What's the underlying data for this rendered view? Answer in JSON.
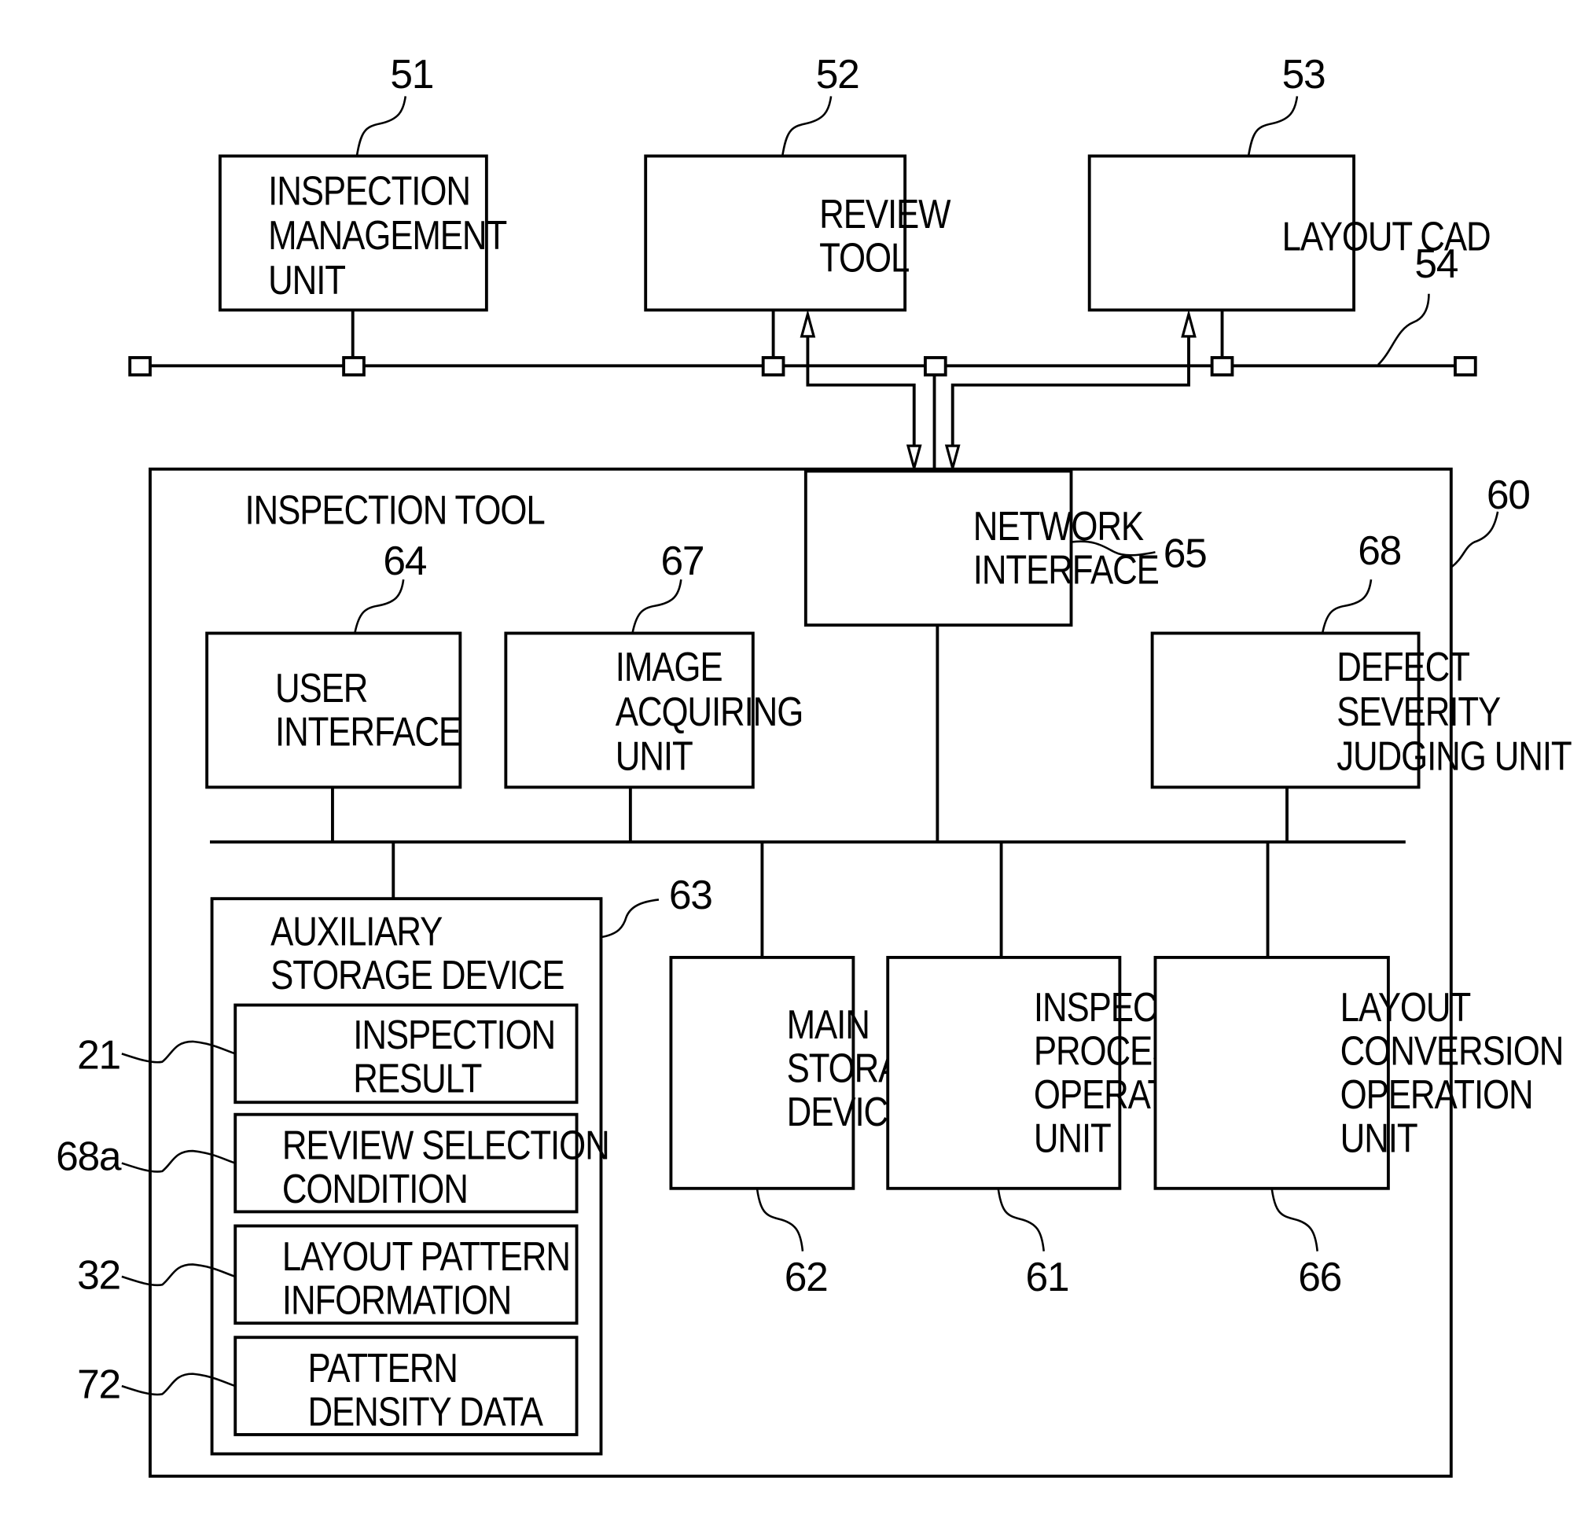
{
  "title": "Inspection system block diagram",
  "network_ref": "54",
  "top_units": [
    {
      "ref": "51",
      "lines": [
        "INSPECTION",
        "MANAGEMENT",
        "UNIT"
      ]
    },
    {
      "ref": "52",
      "lines": [
        "REVIEW",
        "TOOL"
      ]
    },
    {
      "ref": "53",
      "lines": [
        "LAYOUT  CAD"
      ]
    }
  ],
  "inspection_tool": {
    "ref": "60",
    "title": "INSPECTION  TOOL",
    "network_interface": {
      "ref": "65",
      "lines": [
        "NETWORK",
        "INTERFACE"
      ]
    },
    "user_interface": {
      "ref": "64",
      "lines": [
        "USER",
        "INTERFACE"
      ]
    },
    "image_acquiring_unit": {
      "ref": "67",
      "lines": [
        "IMAGE",
        "ACQUIRING",
        "UNIT"
      ]
    },
    "defect_severity_judging_unit": {
      "ref": "68",
      "lines": [
        "DEFECT",
        "SEVERITY",
        "JUDGING  UNIT"
      ]
    },
    "auxiliary_storage_device": {
      "ref": "63",
      "lines": [
        "AUXILIARY",
        "STORAGE  DEVICE"
      ],
      "contents": [
        {
          "ref": "21",
          "lines": [
            "INSPECTION",
            "RESULT"
          ]
        },
        {
          "ref": "68a",
          "lines": [
            "REVIEW  SELECTION",
            "CONDITION"
          ]
        },
        {
          "ref": "32",
          "lines": [
            "LAYOUT  PATTERN",
            "INFORMATION"
          ]
        },
        {
          "ref": "72",
          "lines": [
            "PATTERN",
            "DENSITY  DATA"
          ]
        }
      ]
    },
    "main_storage_device": {
      "ref": "62",
      "lines": [
        "MAIN",
        "STORAGE",
        "DEVICE"
      ]
    },
    "inspection_processing_operation_unit": {
      "ref": "61",
      "lines": [
        "INSPECTION",
        "PROCESSING",
        "OPERATION",
        "UNIT"
      ]
    },
    "layout_conversion_operation_unit": {
      "ref": "66",
      "lines": [
        "LAYOUT",
        "CONVERSION",
        "OPERATION",
        "UNIT"
      ]
    }
  }
}
